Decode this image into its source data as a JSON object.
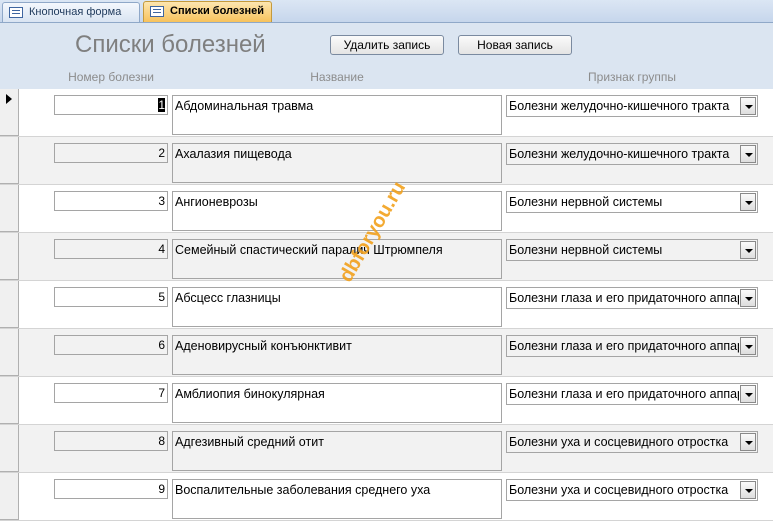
{
  "tabs": [
    {
      "label": "Кнопочная форма",
      "active": false
    },
    {
      "label": "Списки болезней",
      "active": true
    }
  ],
  "form": {
    "title": "Списки болезней",
    "delete_label": "Удалить запись",
    "new_label": "Новая запись"
  },
  "columns": {
    "number": "Номер болезни",
    "name": "Название",
    "group": "Признак группы"
  },
  "records": [
    {
      "id": "1",
      "name": "Абдоминальная травма",
      "group": "Болезни желудочно-кишечного тракта"
    },
    {
      "id": "2",
      "name": "Ахалазия пищевода",
      "group": "Болезни желудочно-кишечного тракта"
    },
    {
      "id": "3",
      "name": "Ангионеврозы",
      "group": "Болезни нервной системы"
    },
    {
      "id": "4",
      "name": "Семейный спастический паралич Штрюмпеля",
      "group": "Болезни нервной системы"
    },
    {
      "id": "5",
      "name": "Абсцесс глазницы",
      "group": "Болезни глаза и его придаточного аппарата"
    },
    {
      "id": "6",
      "name": "Аденовирусный конъюнктивит",
      "group": "Болезни глаза и его придаточного аппарата"
    },
    {
      "id": "7",
      "name": "Амблиопия бинокулярная",
      "group": "Болезни глаза и его придаточного аппарата"
    },
    {
      "id": "8",
      "name": "Адгезивный средний отит",
      "group": "Болезни уха и сосцевидного отростка"
    },
    {
      "id": "9",
      "name": "Воспалительные заболевания среднего уха",
      "group": "Болезни уха и сосцевидного отростка"
    }
  ],
  "watermark": "dbforyou.ru"
}
